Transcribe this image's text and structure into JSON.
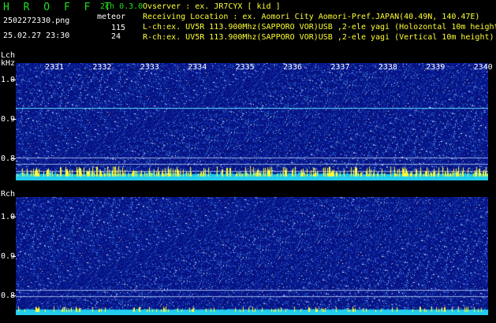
{
  "header": {
    "app_logo": "H R O F F T",
    "file_name": "2502272330.png",
    "datetime": "25.02.27 23:30",
    "channel": "2ch 0.3.0",
    "mode": "meteor",
    "count_l": "115",
    "count_r": "24"
  },
  "info": {
    "observer": "Ovserver           : ex. JR7CYX [ kid ]",
    "location": "Receiving Location : ex. Aomori City Aomori-Pref.JAPAN(40.49N, 140.47E)",
    "lch": "L-ch:ex. UV5R 113.900Mhz(SAPPORO VOR)USB ,2-ele yagi (Holozontal 10m height)",
    "rch": "R-ch:ex. UV5R 113.900Mhz(SAPPORO VOR)USB ,2-ele yagi (Vertical 10m height)"
  },
  "lch": {
    "label": "Lch",
    "unit": "kHz",
    "ticks": [
      "1.0",
      "0.9",
      "0.8"
    ]
  },
  "rch": {
    "label": "Rch",
    "ticks": [
      "1.0",
      "0.9",
      "0.8"
    ]
  },
  "time_labels": [
    "2331",
    "2332",
    "2333",
    "2334",
    "2335",
    "2336",
    "2337",
    "2338",
    "2339",
    "2340"
  ],
  "colors": {
    "background": "#000000",
    "spectrum": "#0a1a8c",
    "signal": "#22ccee",
    "meteor": "#ffff33",
    "text": "#22dd22"
  }
}
